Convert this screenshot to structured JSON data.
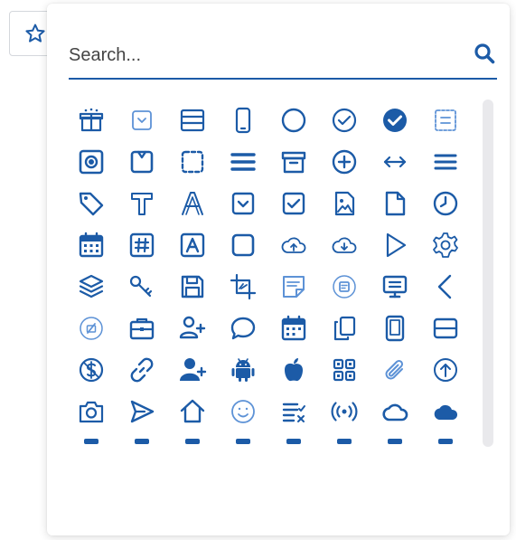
{
  "trigger": {
    "icon": "star-outline-icon"
  },
  "search": {
    "placeholder": "Search...",
    "value": "",
    "icon": "search-icon"
  },
  "colors": {
    "accent": "#1c5ba7",
    "light": "#5d92d6",
    "scrollbar": "#e9e9ec"
  },
  "icons": [
    [
      "gift-icon",
      "checkbox-dropdown-icon",
      "layout-panel-icon",
      "mobile-phone-icon",
      "circle-icon",
      "check-circle-outline-icon",
      "check-circle-filled-icon",
      "dashed-list-icon"
    ],
    [
      "radio-button-square-icon",
      "square-notch-icon",
      "dashed-square-icon",
      "thick-lines-icon",
      "archive-box-icon",
      "plus-circle-icon",
      "horizontal-arrows-icon",
      "hamburger-lines-icon"
    ],
    [
      "tag-icon",
      "text-t-icon",
      "text-a-icon",
      "dropdown-square-icon",
      "checkbox-checked-icon",
      "image-file-icon",
      "blank-file-icon",
      "clock-icon"
    ],
    [
      "calendar-icon",
      "hashtag-square-icon",
      "a-square-icon",
      "square-outline-icon",
      "cloud-upload-icon",
      "cloud-download-icon",
      "play-triangle-icon",
      "gear-icon"
    ],
    [
      "layers-icon",
      "key-icon",
      "floppy-save-icon",
      "crop-icon",
      "note-icon",
      "note-circle-icon",
      "monitor-icon",
      "chevron-left-icon"
    ],
    [
      "no-image-circle-icon",
      "briefcase-icon",
      "add-user-icon",
      "speech-bubble-icon",
      "calendar-grid-icon",
      "copy-pages-icon",
      "tablet-icon",
      "server-drive-icon"
    ],
    [
      "dollar-circle-icon",
      "chain-link-icon",
      "user-add-solid-icon",
      "android-icon",
      "apple-icon",
      "qr-code-icon",
      "paperclip-icon",
      "arrow-up-circle-icon"
    ],
    [
      "camera-icon",
      "send-paper-plane-icon",
      "home-icon",
      "smiley-icon",
      "checklist-icon",
      "broadcast-icon",
      "cloud-outline-icon",
      "cloud-filled-icon"
    ],
    [
      "partial-icon",
      "partial-icon",
      "partial-icon",
      "partial-icon",
      "partial-icon",
      "partial-icon",
      "partial-icon",
      "partial-icon"
    ]
  ]
}
